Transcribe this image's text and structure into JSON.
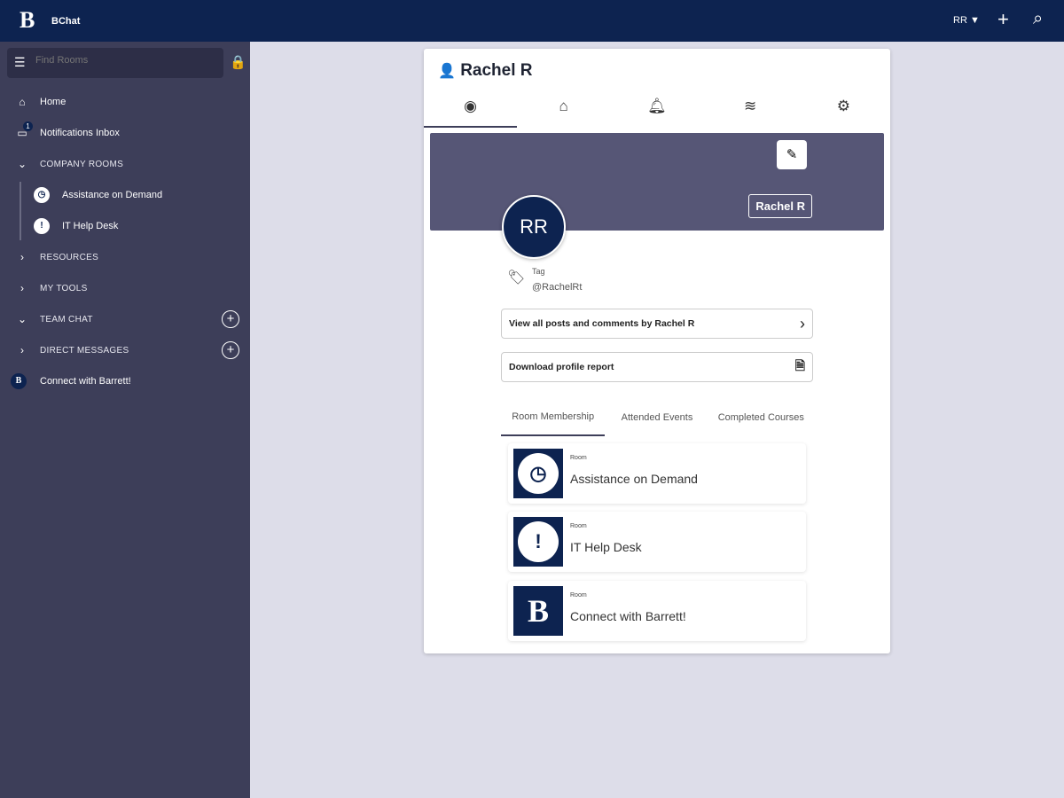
{
  "header": {
    "logo": "B",
    "app_name": "BChat",
    "user_initials": "RR",
    "user_caret": "▼",
    "add": "+",
    "search": "⌕"
  },
  "sidebar": {
    "search_placeholder": "Find Rooms",
    "search_icon": "☰",
    "lock": "🔒",
    "home": "Home",
    "notifications": "Notifications Inbox",
    "notif_count": "1",
    "company_rooms": "COMPANY ROOMS",
    "rooms": [
      {
        "label": "Assistance on Demand",
        "glyph": "◷"
      },
      {
        "label": "IT Help Desk",
        "glyph": "!"
      }
    ],
    "resources": "RESOURCES",
    "my_tools": "MY TOOLS",
    "team_chat": "TEAM CHAT",
    "direct_messages": "DIRECT MESSAGES",
    "connect": "Connect with Barrett!",
    "connect_glyph": "B",
    "plus": "+",
    "chev_down": "⌄",
    "chev_right": "›"
  },
  "profile": {
    "name": "Rachel R",
    "initials": "RR",
    "tag_label": "Tag",
    "tag_value": "@RachelRt",
    "view_posts": "View all posts and comments by Rachel R",
    "download": "Download profile report",
    "tabs": [
      "Room Membership",
      "Attended Events",
      "Completed Courses"
    ],
    "rooms": [
      {
        "label": "Room",
        "name": "Assistance on Demand",
        "glyph": "◷"
      },
      {
        "label": "Room",
        "name": "IT Help Desk",
        "glyph": "!"
      },
      {
        "label": "Room",
        "name": "Connect with Barrett!",
        "glyph": "B"
      }
    ]
  }
}
